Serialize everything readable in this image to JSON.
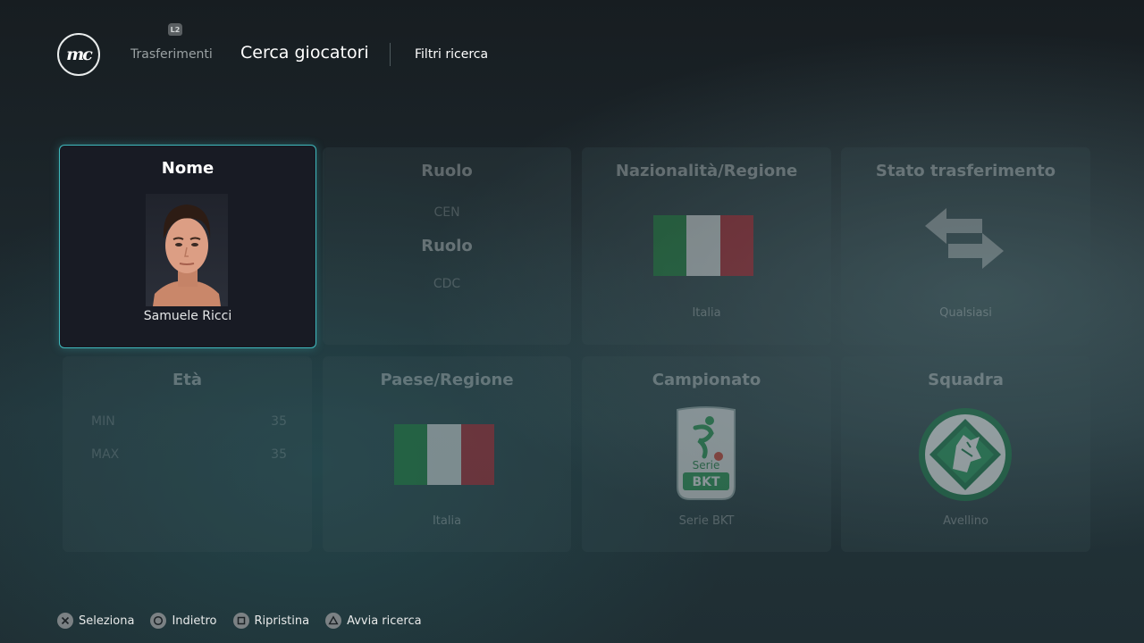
{
  "header": {
    "logo_text": "mc",
    "l2_badge": "L2",
    "prev_tab": "Trasferimenti",
    "current_tab": "Cerca giocatori",
    "sub_tab": "Filtri ricerca"
  },
  "tiles": {
    "nome": {
      "title": "Nome",
      "player_name": "Samuele Ricci"
    },
    "ruolo": {
      "title": "Ruolo",
      "prev": "CEN",
      "current": "Ruolo",
      "next": "CDC"
    },
    "nazionalita": {
      "title": "Nazionalità/Regione",
      "value": "Italia",
      "flag_colors": [
        "#1f8a3c",
        "#f1f1f1",
        "#c4242f"
      ]
    },
    "stato": {
      "title": "Stato trasferimento",
      "value": "Qualsiasi"
    },
    "eta": {
      "title": "Età",
      "min_label": "MIN",
      "min_value": "35",
      "max_label": "MAX",
      "max_value": "35"
    },
    "paese": {
      "title": "Paese/Regione",
      "value": "Italia"
    },
    "campionato": {
      "title": "Campionato",
      "value": "Serie BKT",
      "logo_text_1": "Serie",
      "logo_text_2": "BKT"
    },
    "squadra": {
      "title": "Squadra",
      "value": "Avellino"
    }
  },
  "footer": {
    "select": "Seleziona",
    "back": "Indietro",
    "reset": "Ripristina",
    "search": "Avvia ricerca"
  },
  "colors": {
    "accent": "#3fb9bd"
  }
}
